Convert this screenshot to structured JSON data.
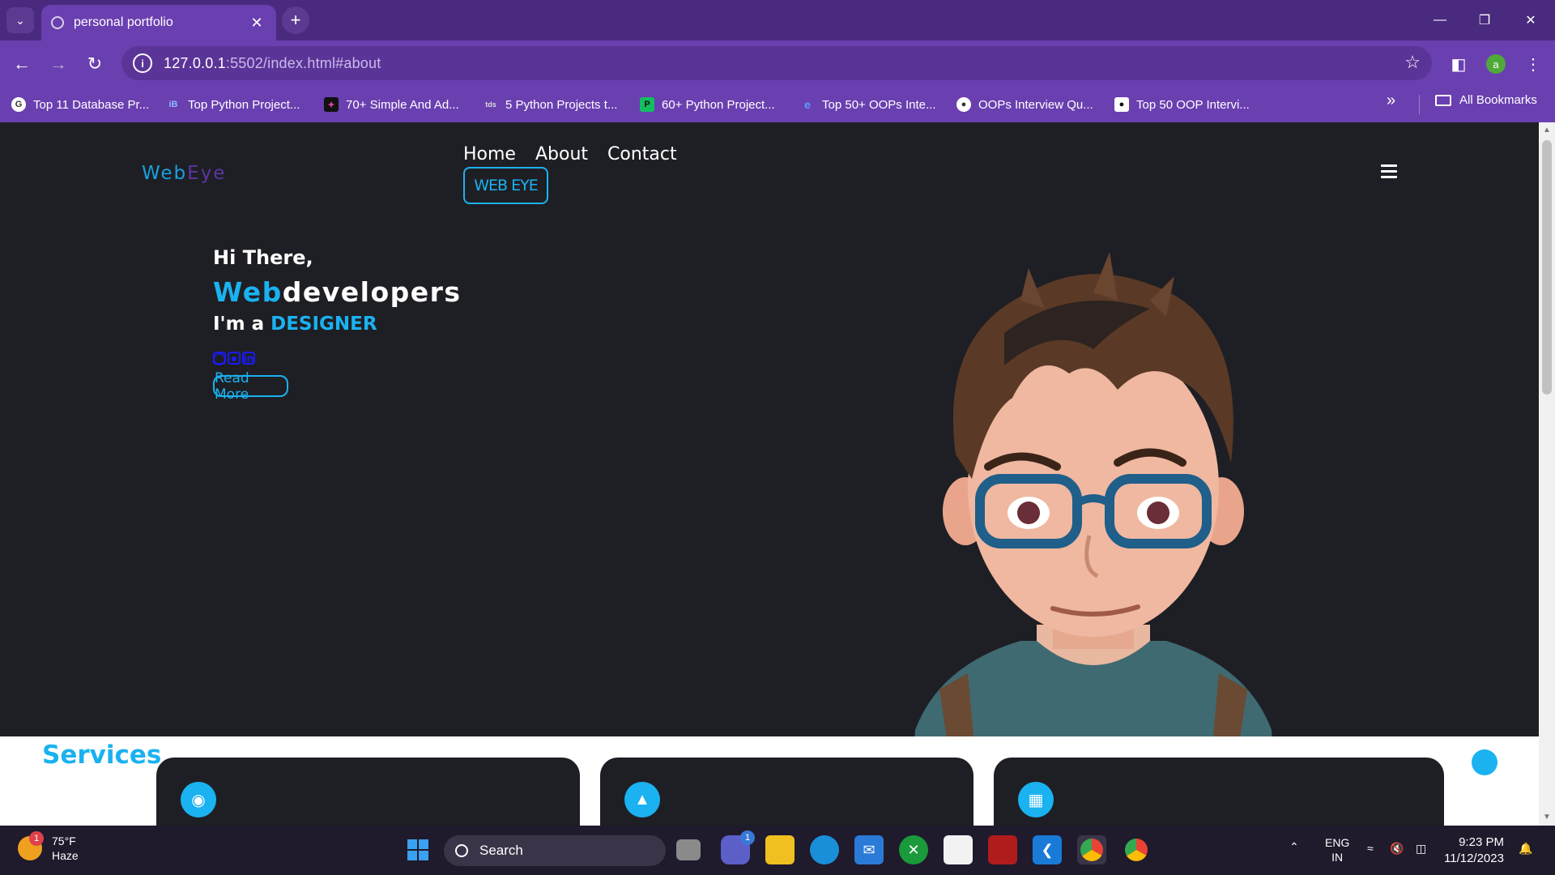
{
  "browser": {
    "tab_title": "personal portfolio",
    "url_host": "127.0.0.1",
    "url_rest": ":5502/index.html#about",
    "profile_initial": "a",
    "bookmarks": [
      "Top 11 Database Pr...",
      "Top Python Project...",
      "70+ Simple And Ad...",
      "5 Python Projects t...",
      "60+ Python Project...",
      "Top 50+ OOPs Inte...",
      "OOPs Interview Qu...",
      "Top 50 OOP Intervi..."
    ],
    "all_bookmarks": "All Bookmarks"
  },
  "site": {
    "logo_part1": "Web",
    "logo_part2": "Eye",
    "nav": [
      "Home",
      "About",
      "Contact"
    ],
    "brand_button": "WEB EYE",
    "greeting": "Hi There,",
    "headline_blue": "Web",
    "headline_white": "developers",
    "role_prefix": "I'm a ",
    "role": "DESIGNER",
    "read_more": "Read More",
    "services_title": "Services"
  },
  "taskbar": {
    "temperature": "75°F",
    "weather": "Haze",
    "weather_badge": "1",
    "search_placeholder": "Search",
    "teams_badge": "1",
    "lang_line1": "ENG",
    "lang_line2": "IN",
    "time": "9:23 PM",
    "date": "11/12/2023"
  },
  "colors": {
    "accent": "#1ab2f0",
    "browser_frame": "#6a3fb0",
    "page_bg": "#1e1f24"
  }
}
